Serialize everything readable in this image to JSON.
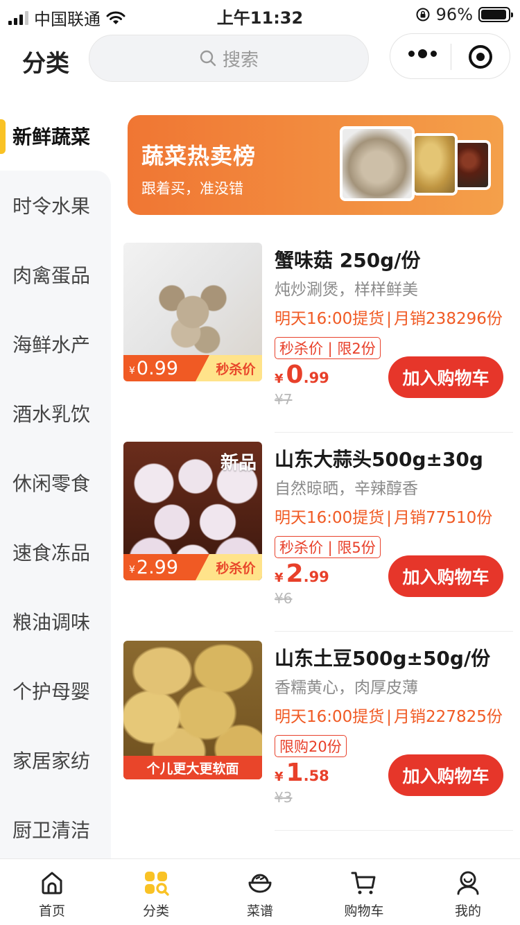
{
  "status_bar": {
    "carrier": "中国联通",
    "time": "上午11:32",
    "battery": "96%",
    "battery_level": 0.96
  },
  "header": {
    "title": "分类",
    "search_placeholder": "搜索"
  },
  "sidebar": {
    "items": [
      {
        "label": "新鲜蔬菜",
        "active": true
      },
      {
        "label": "时令水果"
      },
      {
        "label": "肉禽蛋品"
      },
      {
        "label": "海鲜水产"
      },
      {
        "label": "酒水乳饮"
      },
      {
        "label": "休闲零食"
      },
      {
        "label": "速食冻品"
      },
      {
        "label": "粮油调味"
      },
      {
        "label": "个护母婴"
      },
      {
        "label": "家居家纺"
      },
      {
        "label": "厨卫清洁"
      }
    ],
    "accent_color": "#f9c225"
  },
  "banner": {
    "title": "蔬菜热卖榜",
    "subtitle": "跟着买，准没错"
  },
  "products": [
    {
      "name": "蟹味菇 250g/份",
      "desc": "炖炒涮煲，样样鲜美",
      "pickup": "明天16:00提货",
      "sep": "|",
      "sales": "月销238296份",
      "tag": "秒杀价 | 限2份",
      "yen": "¥",
      "price_int": "0",
      "price_dec": ".99",
      "orig_price": "¥7",
      "image_price": "0.99",
      "image_label": "秒杀价",
      "button": "加入购物车",
      "image": "mushroom-image"
    },
    {
      "name": "山东大蒜头500g±30g",
      "desc": "自然晾晒，辛辣醇香",
      "pickup": "明天16:00提货",
      "sep": "|",
      "sales": "月销77510份",
      "tag": "秒杀价 | 限5份",
      "yen": "¥",
      "price_int": "2",
      "price_dec": ".99",
      "orig_price": "¥6",
      "image_price": "2.99",
      "image_label": "秒杀价",
      "new_badge": "新品",
      "button": "加入购物车",
      "image": "garlic-image"
    },
    {
      "name": "山东土豆500g±50g/份",
      "desc": "香糯黄心，肉厚皮薄",
      "pickup": "明天16:00提货",
      "sep": "|",
      "sales": "月销227825份",
      "tag": "限购20份",
      "yen": "¥",
      "price_int": "1",
      "price_dec": ".58",
      "orig_price": "¥3",
      "image_band": "个儿更大更软面",
      "button": "加入购物车",
      "image": "potato-image"
    }
  ],
  "tabbar": {
    "items": [
      {
        "label": "首页",
        "icon": "home-icon"
      },
      {
        "label": "分类",
        "icon": "category-icon",
        "active": true
      },
      {
        "label": "菜谱",
        "icon": "recipe-icon"
      },
      {
        "label": "购物车",
        "icon": "cart-icon"
      },
      {
        "label": "我的",
        "icon": "profile-icon"
      }
    ],
    "active_color": "#f9c225"
  },
  "colors": {
    "brand_red": "#e6362a",
    "orange": "#f05a24",
    "banner_start": "#f07633",
    "banner_end": "#f4a04a"
  }
}
